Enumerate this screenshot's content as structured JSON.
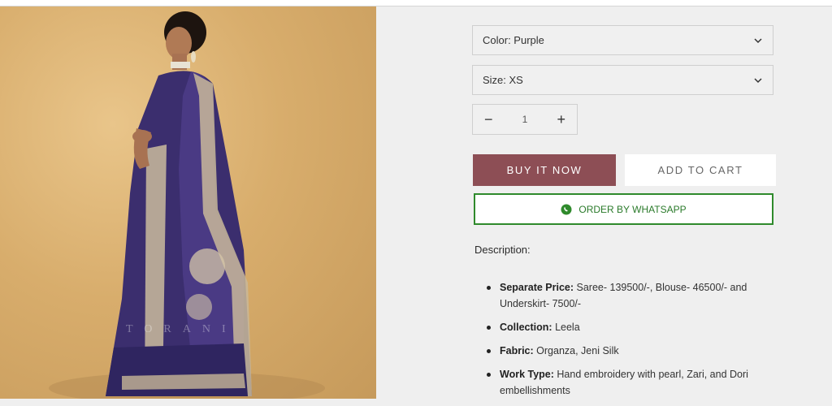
{
  "options": {
    "color_label": "Color: Purple",
    "size_label": "Size: XS"
  },
  "quantity": {
    "minus": "−",
    "value": "1",
    "plus": "+"
  },
  "actions": {
    "buy_now": "BUY IT NOW",
    "add_to_cart": "ADD TO CART",
    "whatsapp": "ORDER BY WHATSAPP"
  },
  "description": {
    "title": "Description:",
    "items": [
      {
        "key": "Separate Price:",
        "value": " Saree- 139500/-, Blouse- 46500/- and Underskirt- 7500/-"
      },
      {
        "key": "Collection:",
        "value": " Leela"
      },
      {
        "key": "Fabric:",
        "value": "  Organza, Jeni Silk"
      },
      {
        "key": "Work Type:",
        "value": " Hand embroidery with pearl, Zari, and Dori embellishments"
      }
    ]
  },
  "image": {
    "watermark": "TORANI"
  },
  "colors": {
    "buy_button": "#8d4e55",
    "whatsapp_green": "#2f8a2c",
    "saree_purple": "#3b2e6e"
  }
}
